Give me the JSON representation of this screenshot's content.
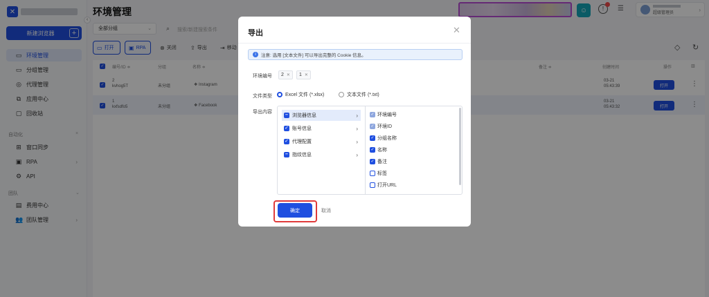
{
  "app": {
    "page_title": "环境管理",
    "new_browser": "新建浏览器",
    "nav_main": [
      {
        "label": "环境管理",
        "icon": "layout-icon"
      },
      {
        "label": "分组管理",
        "icon": "folder-icon"
      },
      {
        "label": "代理管理",
        "icon": "proxy-icon"
      },
      {
        "label": "应用中心",
        "icon": "app-icon"
      },
      {
        "label": "回收站",
        "icon": "trash-icon"
      }
    ],
    "section_automation": "自动化",
    "nav_auto": [
      {
        "label": "窗口同步",
        "icon": "sync-icon"
      },
      {
        "label": "RPA",
        "icon": "rpa-icon"
      },
      {
        "label": "API",
        "icon": "api-icon"
      }
    ],
    "section_team": "团队",
    "nav_team": [
      {
        "label": "费用中心",
        "icon": "billing-icon"
      },
      {
        "label": "团队管理",
        "icon": "team-icon"
      }
    ],
    "user_role": "超级管理员"
  },
  "filters": {
    "group": "全部分组",
    "search_placeholder": "搜索/新建搜索条件"
  },
  "toolbar": {
    "open": "打开",
    "rpa": "RPA",
    "close": "关闭",
    "export": "导出",
    "move": "移动"
  },
  "table": {
    "headers": {
      "serial": "编号/ID ≑",
      "group": "分组",
      "name": "名称 ≑",
      "remark": "备注 ≑",
      "created": "创建时间",
      "action": "操作"
    },
    "rows": [
      {
        "serial": "2",
        "id": "kvhog5T",
        "group": "未分组",
        "name": "Instagram",
        "created_date": "03-21",
        "created_time": "05:43:39",
        "open": "打开"
      },
      {
        "serial": "1",
        "id": "kxfsdfo5",
        "group": "未分组",
        "name": "Facebook",
        "created_date": "03-21",
        "created_time": "05:43:32",
        "open": "打开"
      }
    ]
  },
  "dialog": {
    "title": "导出",
    "notice": "注意: 选用 [文本文件] 可以导出完整的 Cookie 信息。",
    "env_label": "环境编号",
    "env_tags": [
      "2",
      "1"
    ],
    "file_type_label": "文件类型",
    "file_types": [
      "Excel 文件 (*.xlsx)",
      "文本文件 (*.txt)"
    ],
    "content_label": "导出内容",
    "categories": [
      "浏览器信息",
      "账号信息",
      "代理配置",
      "指纹信息"
    ],
    "fields": [
      {
        "label": "环境编号",
        "state": "disabled"
      },
      {
        "label": "环境ID",
        "state": "disabled"
      },
      {
        "label": "分组名称",
        "state": "on"
      },
      {
        "label": "名称",
        "state": "on"
      },
      {
        "label": "备注",
        "state": "on"
      },
      {
        "label": "标签",
        "state": "off"
      },
      {
        "label": "打开URL",
        "state": "off"
      }
    ],
    "ok": "确定",
    "cancel": "取消"
  }
}
